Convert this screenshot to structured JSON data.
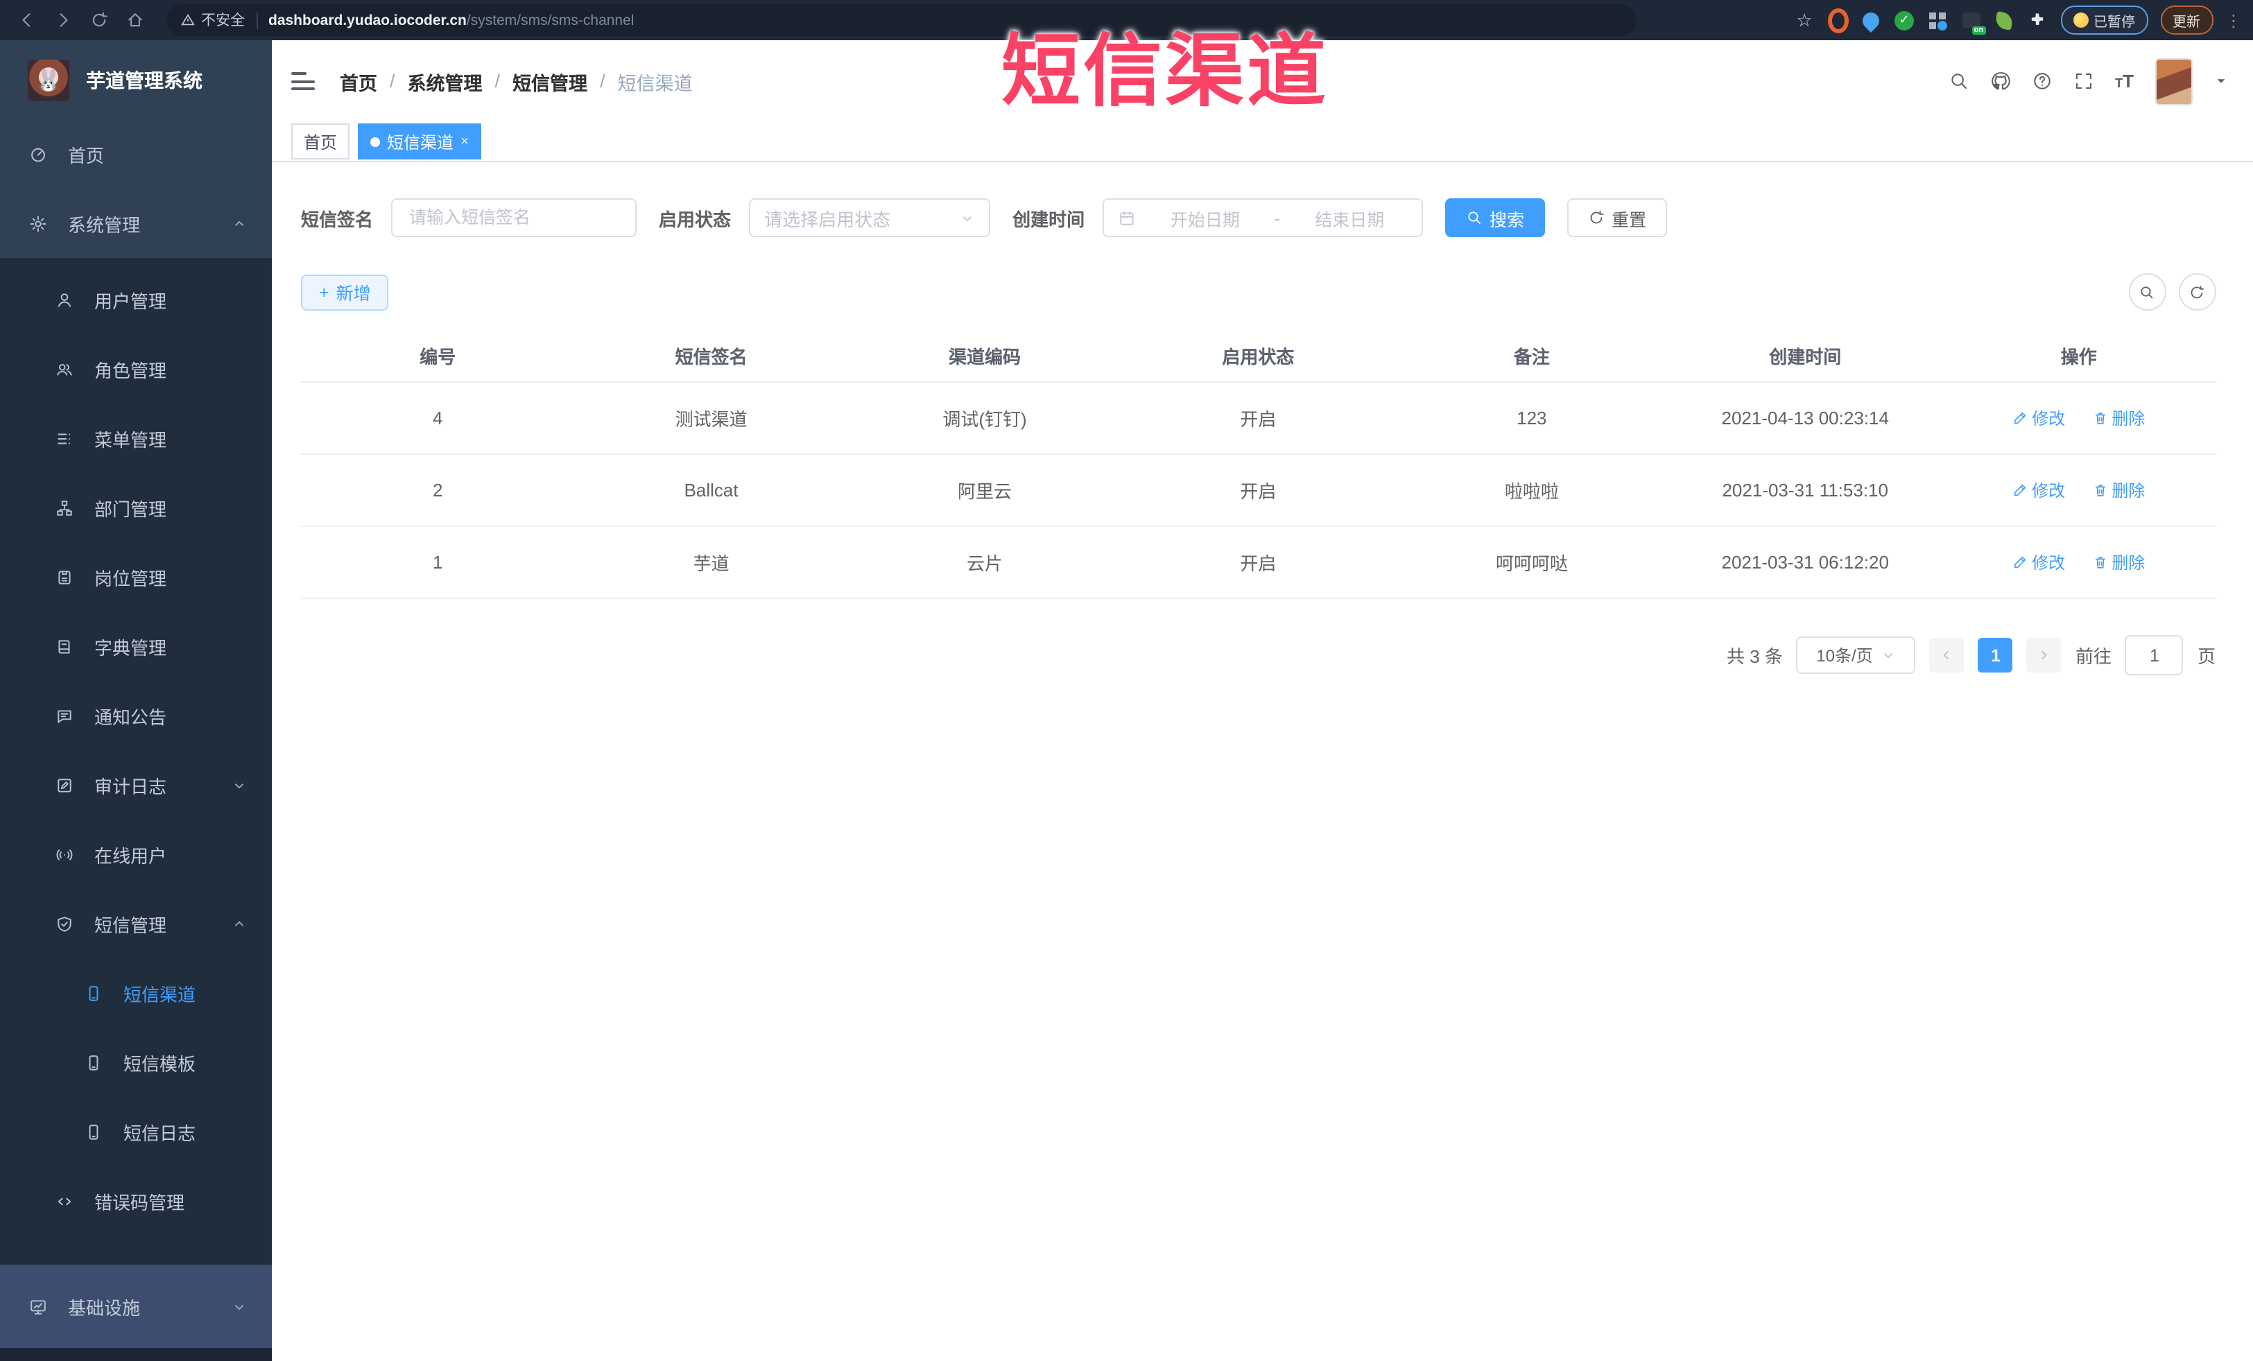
{
  "browser": {
    "security_label": "不安全",
    "url_host": "dashboard.yudao.iocoder.cn",
    "url_path": "/system/sms/sms-channel",
    "paused_badge": "已暂停",
    "update_button": "更新",
    "extension_on_badge": "on",
    "icons": [
      "back-icon",
      "forward-icon",
      "reload-icon",
      "home-icon",
      "warning-icon",
      "bookmark-star-icon",
      "extension-icons",
      "kebab-menu-icon"
    ]
  },
  "overlay": {
    "title": "短信渠道",
    "color": "#f94266"
  },
  "sidebar": {
    "logo_title": "芋道管理系统",
    "items": [
      {
        "label": "首页",
        "icon": "dashboard-icon"
      },
      {
        "label": "系统管理",
        "icon": "gear-icon",
        "chevron": "up"
      },
      {
        "label": "用户管理",
        "icon": "user-icon"
      },
      {
        "label": "角色管理",
        "icon": "users-icon"
      },
      {
        "label": "菜单管理",
        "icon": "menu-list-icon"
      },
      {
        "label": "部门管理",
        "icon": "org-tree-icon"
      },
      {
        "label": "岗位管理",
        "icon": "badge-icon"
      },
      {
        "label": "字典管理",
        "icon": "dictionary-icon"
      },
      {
        "label": "通知公告",
        "icon": "announcement-icon"
      },
      {
        "label": "审计日志",
        "icon": "audit-log-icon",
        "chevron": "down"
      },
      {
        "label": "在线用户",
        "icon": "online-users-icon"
      },
      {
        "label": "短信管理",
        "icon": "sms-shield-icon",
        "chevron": "up"
      },
      {
        "label": "短信渠道",
        "icon": "phone-icon",
        "active": true
      },
      {
        "label": "短信模板",
        "icon": "phone-icon"
      },
      {
        "label": "短信日志",
        "icon": "phone-icon"
      },
      {
        "label": "错误码管理",
        "icon": "code-icon"
      },
      {
        "label": "基础设施",
        "icon": "infrastructure-icon",
        "chevron": "down"
      }
    ]
  },
  "header": {
    "breadcrumb": [
      "首页",
      "系统管理",
      "短信管理",
      "短信渠道"
    ],
    "separator": "/",
    "right_icons": [
      "search-icon",
      "github-icon",
      "help-icon",
      "fullscreen-icon",
      "font-size-icon",
      "avatar",
      "caret-down-icon"
    ]
  },
  "tabs": [
    {
      "label": "首页",
      "active": false
    },
    {
      "label": "短信渠道",
      "active": true,
      "close": "×"
    }
  ],
  "filters": {
    "signature_label": "短信签名",
    "signature_placeholder": "请输入短信签名",
    "status_label": "启用状态",
    "status_placeholder": "请选择启用状态",
    "created_label": "创建时间",
    "date_start_placeholder": "开始日期",
    "date_separator": "-",
    "date_end_placeholder": "结束日期",
    "search_label": "搜索",
    "reset_label": "重置"
  },
  "toolbar": {
    "add_label": "新增"
  },
  "table": {
    "columns": [
      "编号",
      "短信签名",
      "渠道编码",
      "启用状态",
      "备注",
      "创建时间",
      "操作"
    ],
    "rows": [
      {
        "id": "4",
        "signature": "测试渠道",
        "code": "调试(钉钉)",
        "status": "开启",
        "remark": "123",
        "created": "2021-04-13 00:23:14"
      },
      {
        "id": "2",
        "signature": "Ballcat",
        "code": "阿里云",
        "status": "开启",
        "remark": "啦啦啦",
        "created": "2021-03-31 11:53:10"
      },
      {
        "id": "1",
        "signature": "芋道",
        "code": "云片",
        "status": "开启",
        "remark": "呵呵呵哒",
        "created": "2021-03-31 06:12:20"
      }
    ],
    "edit_label": "修改",
    "delete_label": "删除"
  },
  "pagination": {
    "total_text": "共 3 条",
    "page_size": "10条/页",
    "current_page": "1",
    "goto_label": "前往",
    "goto_value": "1",
    "page_unit": "页"
  }
}
